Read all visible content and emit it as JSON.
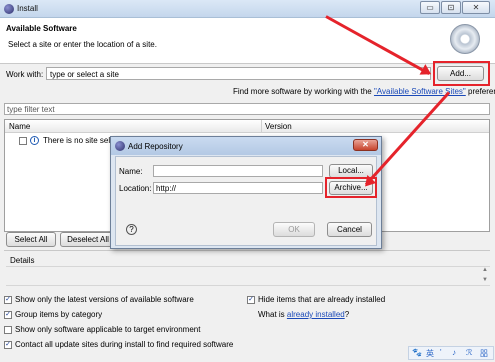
{
  "window": {
    "title": "Install",
    "min": "▭",
    "max": "⊡",
    "close": "✕"
  },
  "banner": {
    "heading": "Available Software",
    "subheading": "Select a site or enter the location of a site."
  },
  "work_with": {
    "label": "Work with:",
    "placeholder": "type or select a site",
    "add_label": "Add..."
  },
  "find_more": {
    "prefix": "Find more software by working with the",
    "link": "\"Available Software Sites\"",
    "suffix": "preferences."
  },
  "filter": {
    "placeholder": "type filter text"
  },
  "table": {
    "col_name": "Name",
    "col_version": "Version",
    "row_text": "There is no site selected."
  },
  "buttons": {
    "select_all": "Select All",
    "deselect_all": "Deselect All"
  },
  "details": {
    "label": "Details"
  },
  "options": {
    "latest_versions": "Show only the latest versions of available software",
    "group_by_category": "Group items by category",
    "target_env": "Show only software applicable to target environment",
    "contact_sites": "Contact all update sites during install to find required software",
    "hide_installed": "Hide items that are already installed",
    "what_is": "What is",
    "already_installed": "already installed",
    "qmark": "?"
  },
  "dialog": {
    "title": "Add Repository",
    "name_label": "Name:",
    "location_label": "Location:",
    "location_value": "http://",
    "local_label": "Local...",
    "archive_label": "Archive...",
    "ok_label": "OK",
    "cancel_label": "Cancel",
    "help_glyph": "?"
  },
  "ime": {
    "glyphs": [
      "🐾",
      "英",
      "'",
      "♪",
      "ℛ",
      "㗊"
    ]
  },
  "colors": {
    "annotation_red": "#e5232b",
    "link_blue": "#1a49b8",
    "dialog_frame": "#dde6f1"
  }
}
